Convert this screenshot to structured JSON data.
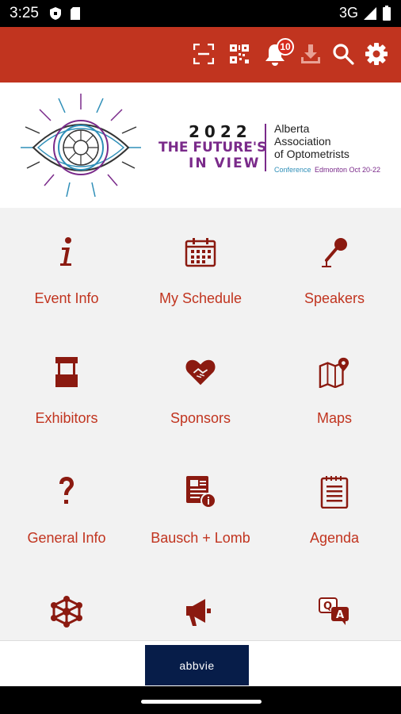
{
  "status_bar": {
    "time": "3:25",
    "network": "3G",
    "left_icons": [
      "shield-icon",
      "sim-card-icon"
    ],
    "right_icons": [
      "signal-icon",
      "battery-icon"
    ]
  },
  "toolbar": {
    "color": "#c1341f",
    "actions": [
      {
        "icon": "scan-frame-icon"
      },
      {
        "icon": "qr-code-icon"
      },
      {
        "icon": "bell-icon",
        "badge": "10"
      },
      {
        "icon": "download-icon"
      },
      {
        "icon": "search-icon"
      },
      {
        "icon": "gear-icon"
      }
    ]
  },
  "banner": {
    "year": "2022",
    "tagline_line1": "THE FUTURE'S",
    "tagline_line2": "IN VIEW",
    "org_line1": "Alberta",
    "org_line2": "Association",
    "org_line3": "of Optometrists",
    "conference_label": "Conference",
    "conference_place_date": "Edmonton Oct 20-22"
  },
  "menu": {
    "accent": "#8b1a10",
    "label_color": "#c1341f",
    "items": [
      {
        "label": "Event Info",
        "icon": "info-icon"
      },
      {
        "label": "My Schedule",
        "icon": "calendar-icon"
      },
      {
        "label": "Speakers",
        "icon": "microphone-icon"
      },
      {
        "label": "Exhibitors",
        "icon": "booth-icon"
      },
      {
        "label": "Sponsors",
        "icon": "heart-handshake-icon"
      },
      {
        "label": "Maps",
        "icon": "map-icon"
      },
      {
        "label": "General Info",
        "icon": "question-icon"
      },
      {
        "label": "Bausch + Lomb",
        "icon": "document-info-icon"
      },
      {
        "label": "Agenda",
        "icon": "notepad-icon"
      },
      {
        "label": "",
        "icon": "network-icon"
      },
      {
        "label": "",
        "icon": "megaphone-icon"
      },
      {
        "label": "",
        "icon": "qa-chat-icon"
      }
    ]
  },
  "ad": {
    "text": "abbvie",
    "background": "#071d49"
  }
}
